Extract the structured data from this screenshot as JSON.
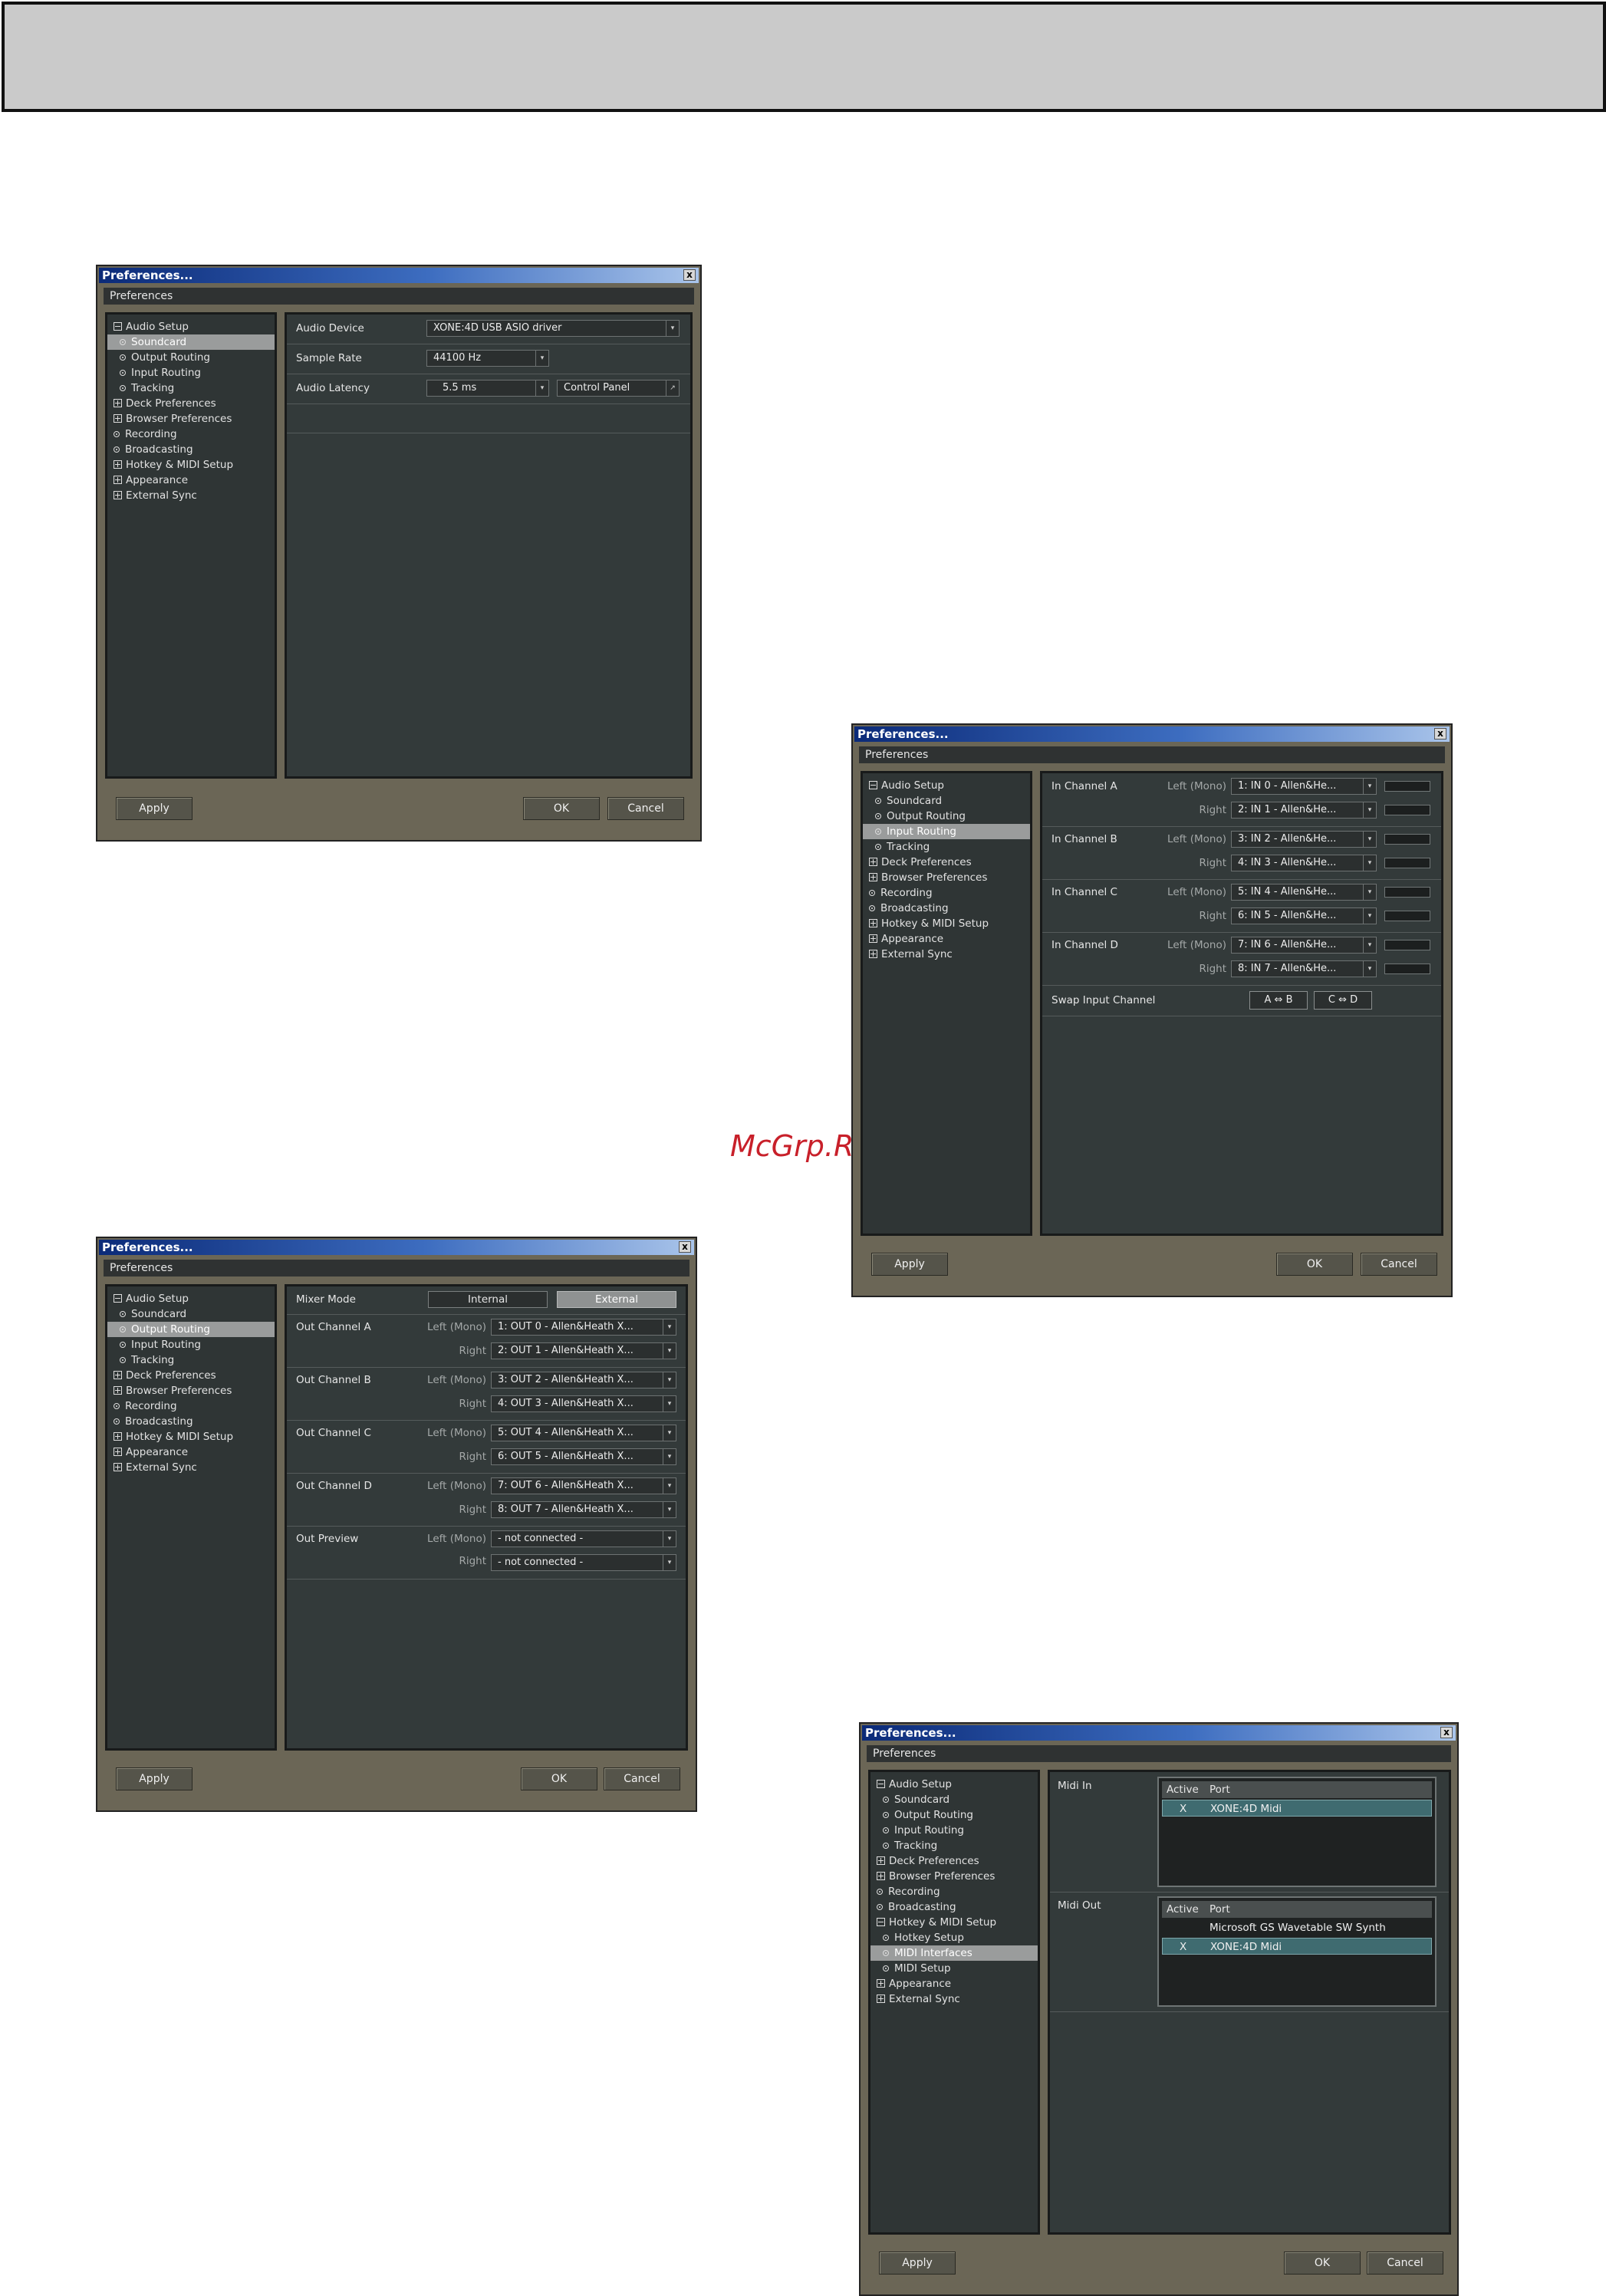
{
  "watermark": "McGrp.Ru",
  "common": {
    "window_title": "Preferences...",
    "close_glyph": "x",
    "pref_header": "Preferences",
    "apply": "Apply",
    "ok": "OK",
    "cancel": "Cancel",
    "arrow": "▾"
  },
  "tree": {
    "audio_setup": "Audio Setup",
    "soundcard": "Soundcard",
    "output_routing": "Output Routing",
    "input_routing": "Input Routing",
    "tracking": "Tracking",
    "deck_prefs": "Deck Preferences",
    "browser_prefs": "Browser Preferences",
    "recording": "Recording",
    "broadcasting": "Broadcasting",
    "hotkey_midi": "Hotkey & MIDI Setup",
    "hotkey_setup": "Hotkey Setup",
    "midi_interfaces": "MIDI Interfaces",
    "midi_setup": "MIDI Setup",
    "appearance": "Appearance",
    "external_sync": "External Sync"
  },
  "soundcard": {
    "audio_device_label": "Audio Device",
    "audio_device_value": "XONE:4D USB ASIO driver",
    "sample_rate_label": "Sample Rate",
    "sample_rate_value": "44100 Hz",
    "latency_label": "Audio Latency",
    "latency_value": "5.5 ms",
    "control_panel": "Control Panel",
    "control_panel_glyph": "↗"
  },
  "input_routing": {
    "left_mono": "Left (Mono)",
    "right": "Right",
    "channels": [
      {
        "name": "In Channel A",
        "left": "1: IN 0 - Allen&He...",
        "right": "2: IN 1 - Allen&He..."
      },
      {
        "name": "In Channel B",
        "left": "3: IN 2 - Allen&He...",
        "right": "4: IN 3 - Allen&He..."
      },
      {
        "name": "In Channel C",
        "left": "5: IN 4 - Allen&He...",
        "right": "6: IN 5 - Allen&He..."
      },
      {
        "name": "In Channel D",
        "left": "7: IN 6 - Allen&He...",
        "right": "8: IN 7 - Allen&He..."
      }
    ],
    "swap_label": "Swap Input Channel",
    "swap_ab": "A ⇔ B",
    "swap_cd": "C ⇔ D"
  },
  "output_routing": {
    "mixer_mode_label": "Mixer Mode",
    "internal": "Internal",
    "external": "External",
    "left_mono": "Left (Mono)",
    "right": "Right",
    "channels": [
      {
        "name": "Out Channel A",
        "left": "1: OUT 0 - Allen&Heath X...",
        "right": "2: OUT 1 - Allen&Heath X..."
      },
      {
        "name": "Out Channel B",
        "left": "3: OUT 2 - Allen&Heath X...",
        "right": "4: OUT 3 - Allen&Heath X..."
      },
      {
        "name": "Out Channel C",
        "left": "5: OUT 4 - Allen&Heath X...",
        "right": "6: OUT 5 - Allen&Heath X..."
      },
      {
        "name": "Out Channel D",
        "left": "7: OUT 6 - Allen&Heath X...",
        "right": "8: OUT 7 - Allen&Heath X..."
      },
      {
        "name": "Out Preview",
        "left": "- not connected -",
        "right": "- not connected -"
      }
    ]
  },
  "midi": {
    "midi_in_label": "Midi In",
    "midi_out_label": "Midi Out",
    "col_active": "Active",
    "col_port": "Port",
    "in_rows": [
      {
        "active": "X",
        "port": "XONE:4D Midi"
      }
    ],
    "out_rows": [
      {
        "active": "",
        "port": "Microsoft GS Wavetable SW Synth"
      },
      {
        "active": "X",
        "port": "XONE:4D Midi"
      }
    ]
  }
}
